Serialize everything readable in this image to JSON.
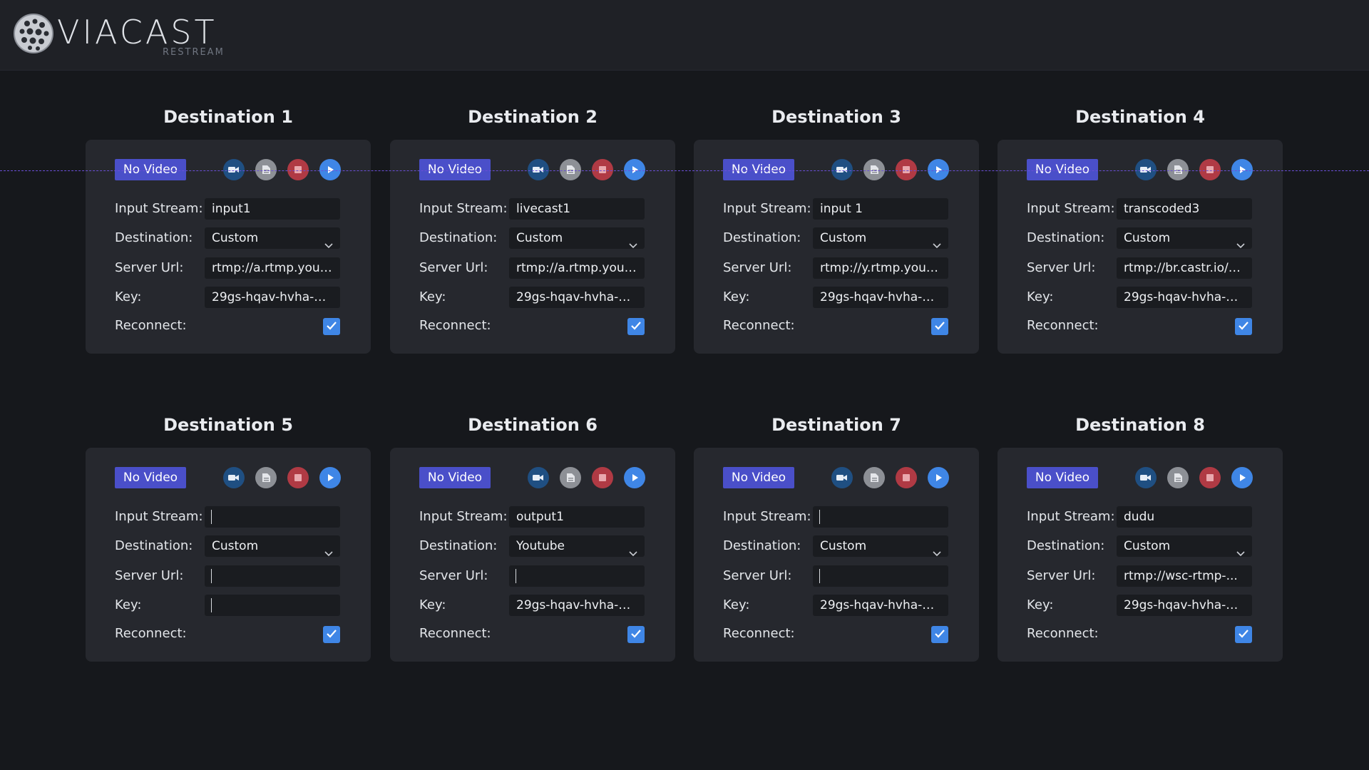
{
  "app": {
    "logo_text": "VIACAST",
    "logo_sub": "RESTREAM"
  },
  "labels": {
    "input_stream": "Input Stream:",
    "destination": "Destination:",
    "server_url": "Server Url:",
    "key": "Key:",
    "reconnect": "Reconnect:",
    "no_video": "No Video"
  },
  "destinations": [
    {
      "title": "Destination 1",
      "input_stream": "input1",
      "destination": "Custom",
      "server_url": "rtmp://a.rtmp.yout...",
      "key": "29gs-hqav-hvha-b...",
      "reconnect": true
    },
    {
      "title": "Destination 2",
      "input_stream": "livecast1",
      "destination": "Custom",
      "server_url": "rtmp://a.rtmp.yout...",
      "key": "29gs-hqav-hvha-b...",
      "reconnect": true
    },
    {
      "title": "Destination 3",
      "input_stream": "input 1",
      "destination": "Custom",
      "server_url": "rtmp://y.rtmp.yout...",
      "key": "29gs-hqav-hvha-b...",
      "reconnect": true
    },
    {
      "title": "Destination 4",
      "input_stream": "transcoded3",
      "destination": "Custom",
      "server_url": "rtmp://br.castr.io/s...",
      "key": "29gs-hqav-hvha-b...",
      "reconnect": true
    },
    {
      "title": "Destination 5",
      "input_stream": "",
      "destination": "Custom",
      "server_url": "",
      "key": "",
      "reconnect": true
    },
    {
      "title": "Destination 6",
      "input_stream": "output1",
      "destination": "Youtube",
      "server_url": "",
      "key": "29gs-hqav-hvha-b...",
      "reconnect": true
    },
    {
      "title": "Destination 7",
      "input_stream": "",
      "destination": "Custom",
      "server_url": "",
      "key": "29gs-hqav-hvha-b...",
      "reconnect": true
    },
    {
      "title": "Destination 8",
      "input_stream": "dudu",
      "destination": "Custom",
      "server_url": "rtmp://wsc-rtmp-...",
      "key": "29gs-hqav-hvha-b...",
      "reconnect": true
    }
  ],
  "icons": {
    "camera": "video-camera-icon",
    "document": "document-icon",
    "stop": "stop-icon",
    "play": "play-icon",
    "chevron": "chevron-down-icon",
    "check": "checkmark-icon"
  },
  "colors": {
    "background": "#16181c",
    "card": "#26282e",
    "no_video_badge": "#4a4fc9",
    "accent_blue": "#3f86e6",
    "stop_red": "#b03a44"
  }
}
